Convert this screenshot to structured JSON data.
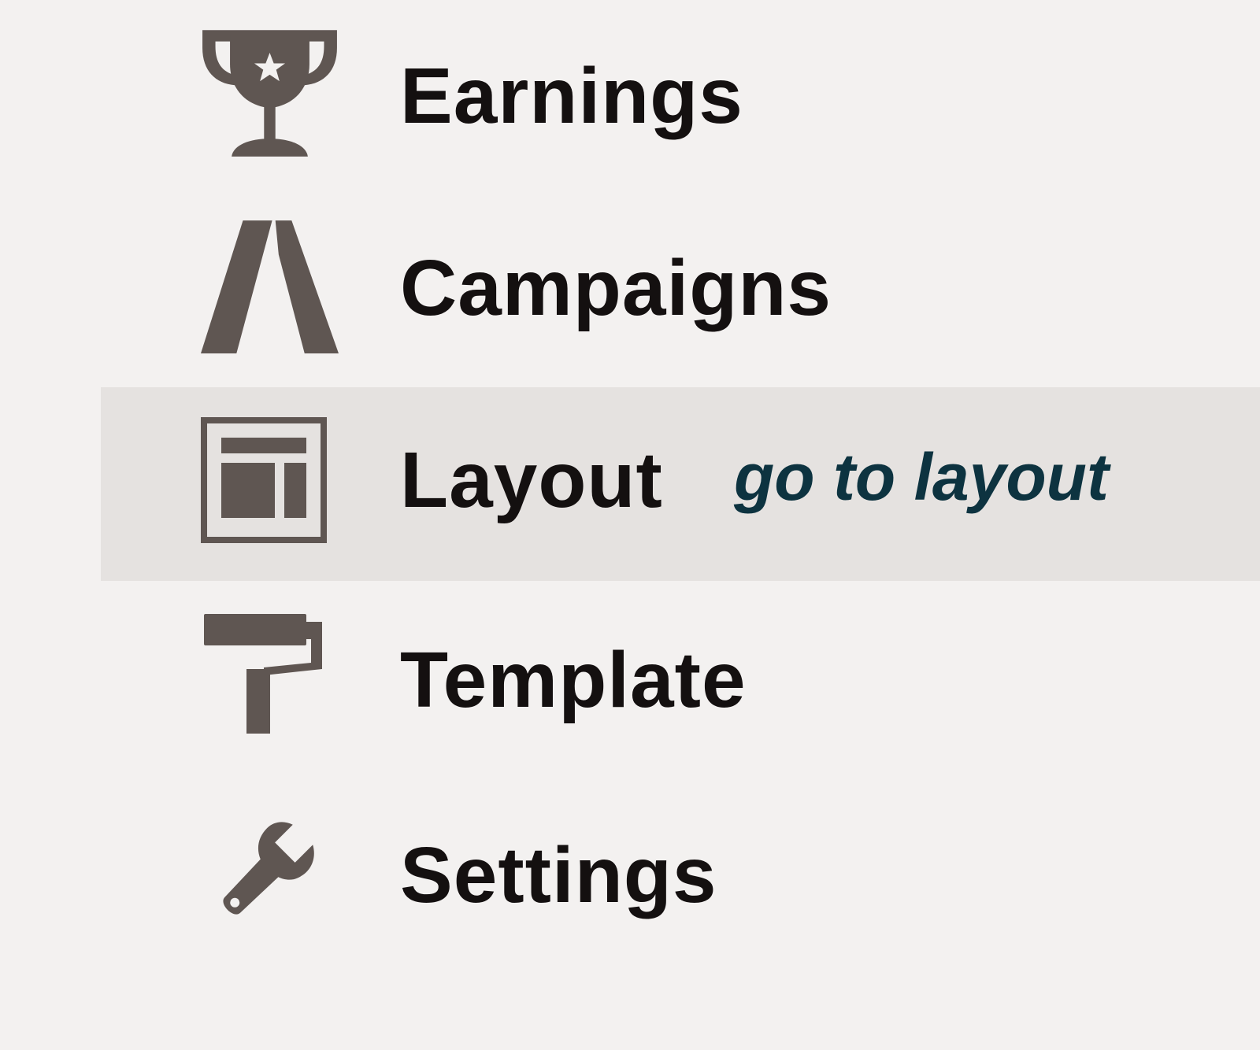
{
  "menu": {
    "items": [
      {
        "label": "Earnings",
        "icon": "trophy-icon"
      },
      {
        "label": "Campaigns",
        "icon": "adwords-icon"
      },
      {
        "label": "Layout",
        "icon": "layout-icon",
        "selected": true
      },
      {
        "label": "Template",
        "icon": "paint-roller-icon"
      },
      {
        "label": "Settings",
        "icon": "wrench-icon"
      }
    ]
  },
  "annotation": {
    "text": "go to layout"
  },
  "colors": {
    "background": "#f3f1f0",
    "selected_background": "#e5e2e0",
    "icon": "#5f5652",
    "label": "#141010",
    "annotation": "#0d3340"
  }
}
